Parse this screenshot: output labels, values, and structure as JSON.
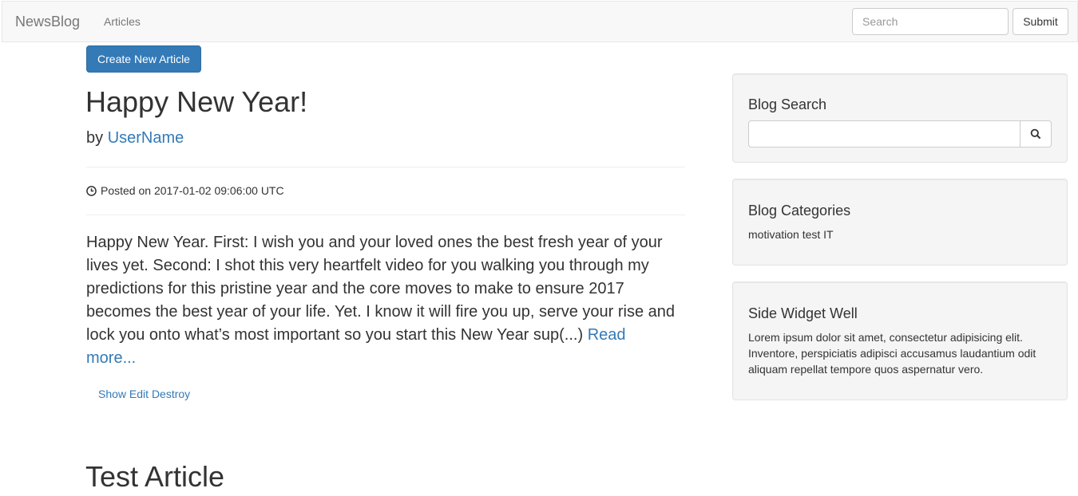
{
  "navbar": {
    "brand": "NewsBlog",
    "articles_link": "Articles",
    "search_placeholder": "Search",
    "submit_label": "Submit"
  },
  "main": {
    "create_button": "Create New Article",
    "post": {
      "title": "Happy New Year!",
      "by_prefix": "by",
      "author": "UserName",
      "posted_on": "Posted on 2017-01-02 09:06:00 UTC",
      "body": "Happy New Year. First: I wish you and your loved ones the best fresh year of your lives yet. Second: I shot this very heartfelt video for you walking you through my predictions for this pristine year and the core moves to make to ensure 2017 becomes the best year of your life. Yet. I know it will fire you up, serve your rise and lock you onto what’s most important so you start this New Year sup(...)",
      "read_more": "Read more...",
      "actions": {
        "show": "Show",
        "edit": "Edit",
        "destroy": "Destroy"
      }
    },
    "next_post_title": "Test Article"
  },
  "sidebar": {
    "search_title": "Blog Search",
    "search_icon": "search-icon",
    "categories_title": "Blog Categories",
    "categories": "motivation test IT",
    "widget_title": "Side Widget Well",
    "widget_text": "Lorem ipsum dolor sit amet, consectetur adipisicing elit. Inventore, perspiciatis adipisci accusamus laudantium odit aliquam repellat tempore quos aspernatur vero."
  },
  "colors": {
    "link": "#337ab7",
    "primary_button": "#337ab7",
    "navbar_bg": "#f8f8f8",
    "well_bg": "#f5f5f5"
  }
}
